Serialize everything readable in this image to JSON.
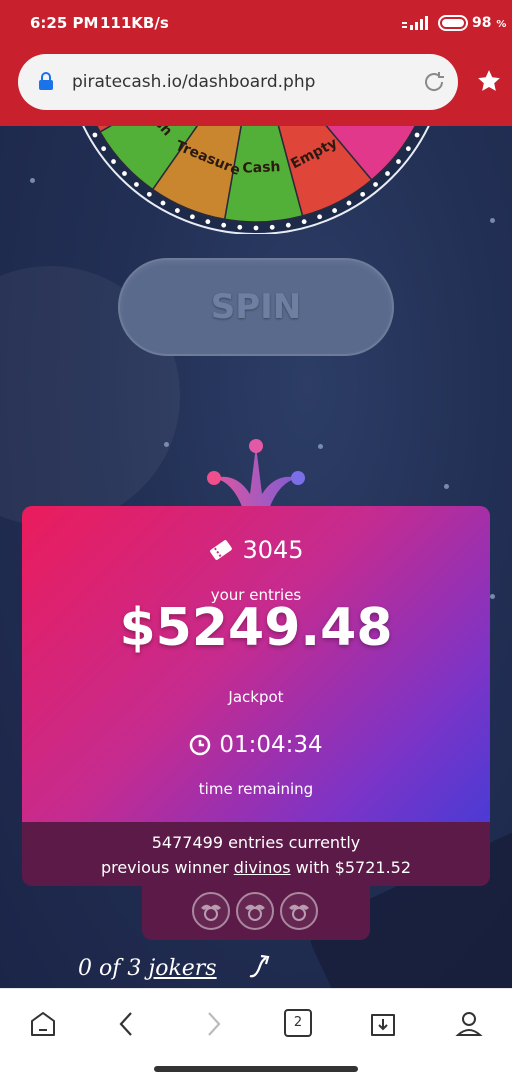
{
  "status_bar": {
    "time": "6:25 PM",
    "net_speed": "111KB/s",
    "battery_pct": "98",
    "battery_unit": "%"
  },
  "browser": {
    "url": "piratecash.io/dashboard.php"
  },
  "wheel": {
    "segments": [
      "sh",
      "Treasure",
      "Cash",
      "Empty"
    ],
    "colors": [
      "#d6413a",
      "#52b038",
      "#c9862f",
      "#52b038",
      "#e0453a",
      "#e2388b"
    ]
  },
  "spin_button": {
    "label": "SPIN"
  },
  "jackpot_card": {
    "entries": "3045",
    "entries_label": "your entries",
    "jackpot": "$5249.48",
    "jackpot_label": "Jackpot",
    "time_remaining": "01:04:34",
    "time_label": "time remaining"
  },
  "info": {
    "entries_current": "5477499 entries currently",
    "winner_prefix": "previous winner",
    "winner_name": "divinos",
    "winner_suffix": "with $5721.52"
  },
  "jokers": {
    "count_text": "0 of 3",
    "link_text": "jokers"
  },
  "nav": {
    "tabs_count": "2"
  },
  "colors": {
    "accent": "#c8202c",
    "card_start": "#ea1c5c",
    "card_end": "#4a3bd4"
  }
}
